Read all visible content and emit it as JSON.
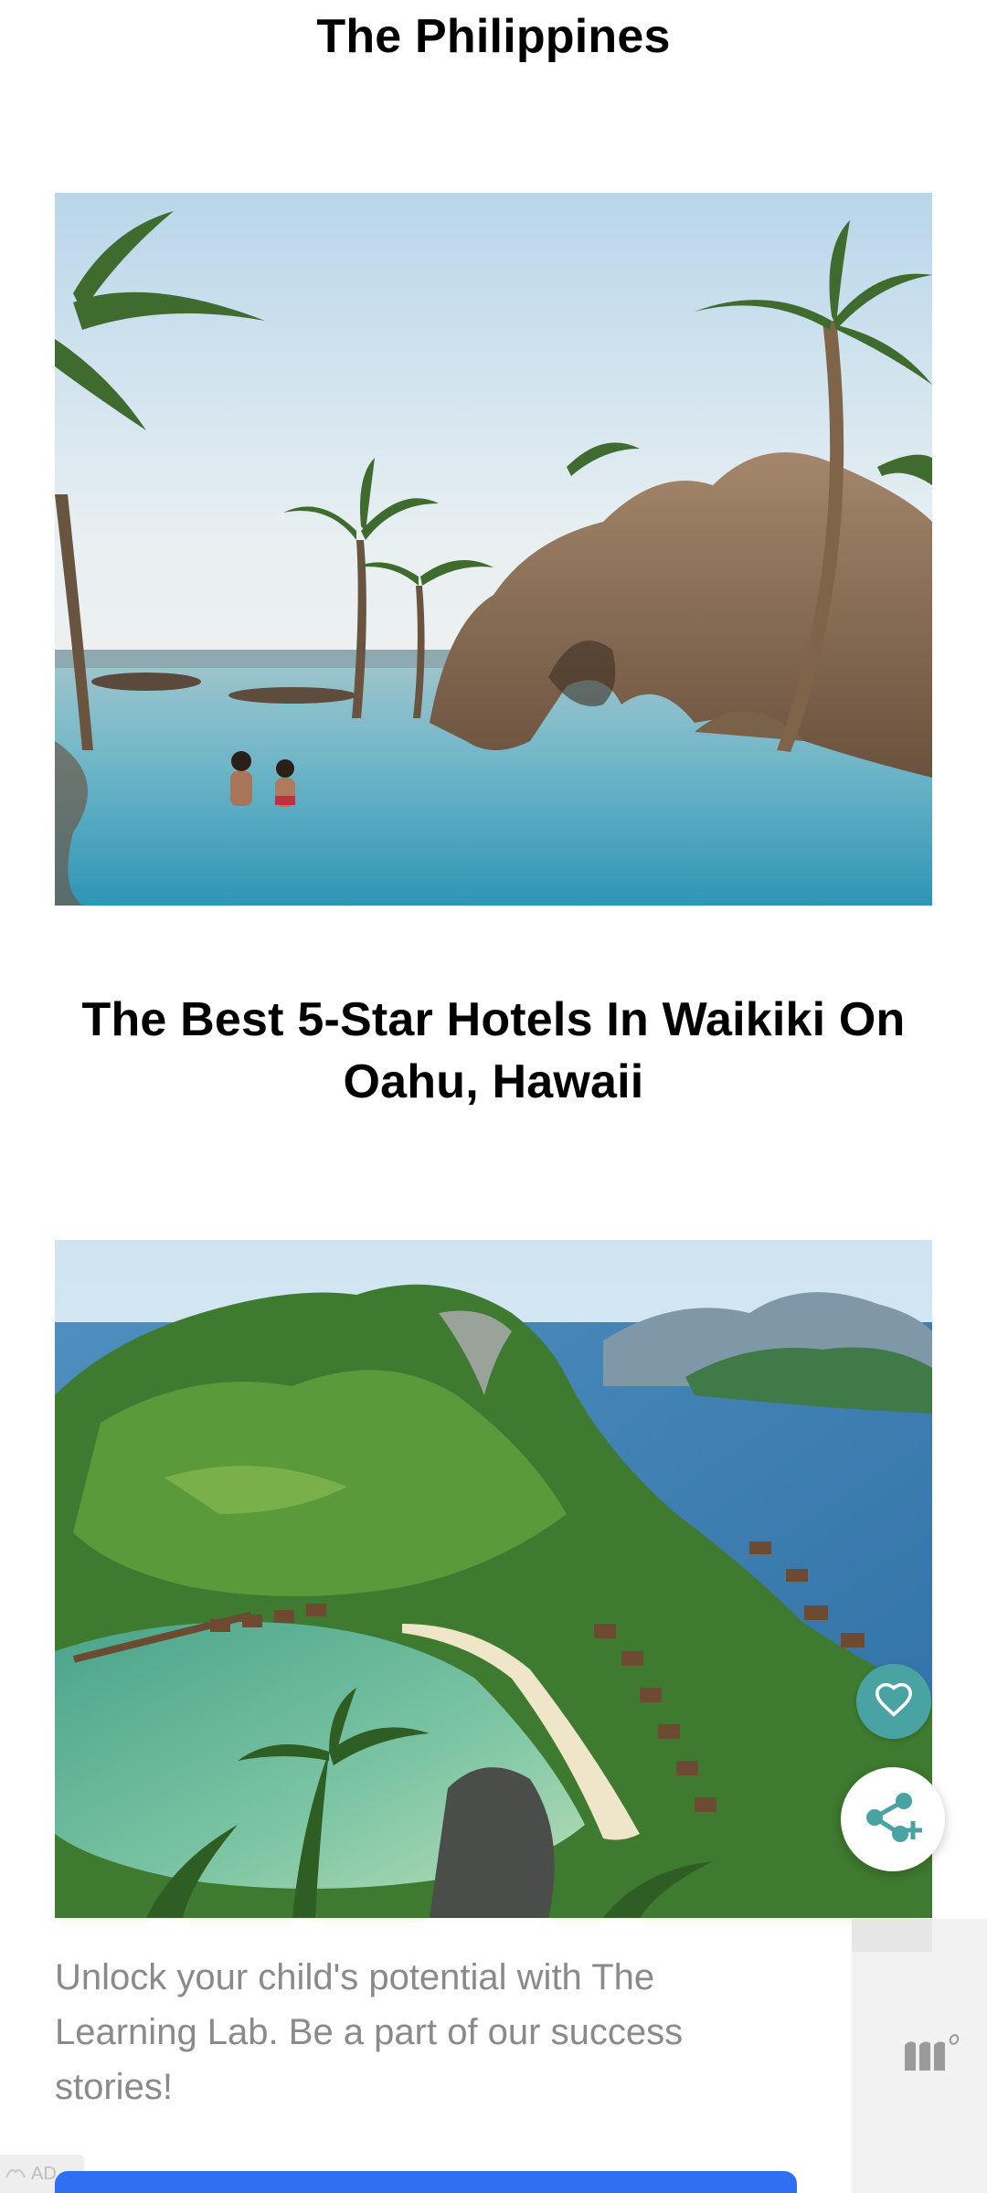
{
  "articles": [
    {
      "title": "The Philippines",
      "image": "resort-lagoon-pool-photo"
    },
    {
      "title": "The Best 5-Star Hotels In Waikiki On Oahu, Hawaii",
      "image": "tropical-island-beach-resort-photo"
    }
  ],
  "actions": {
    "like_icon": "heart-icon",
    "share_icon": "share-icon"
  },
  "ad": {
    "text": "Unlock your child's potential with The Learning Lab. Be a part of our success stories!",
    "badge": "AD"
  },
  "colors": {
    "like_button": "#4aa3a3",
    "cta_button": "#2f6ff1",
    "ad_text": "#8a8a8a"
  }
}
